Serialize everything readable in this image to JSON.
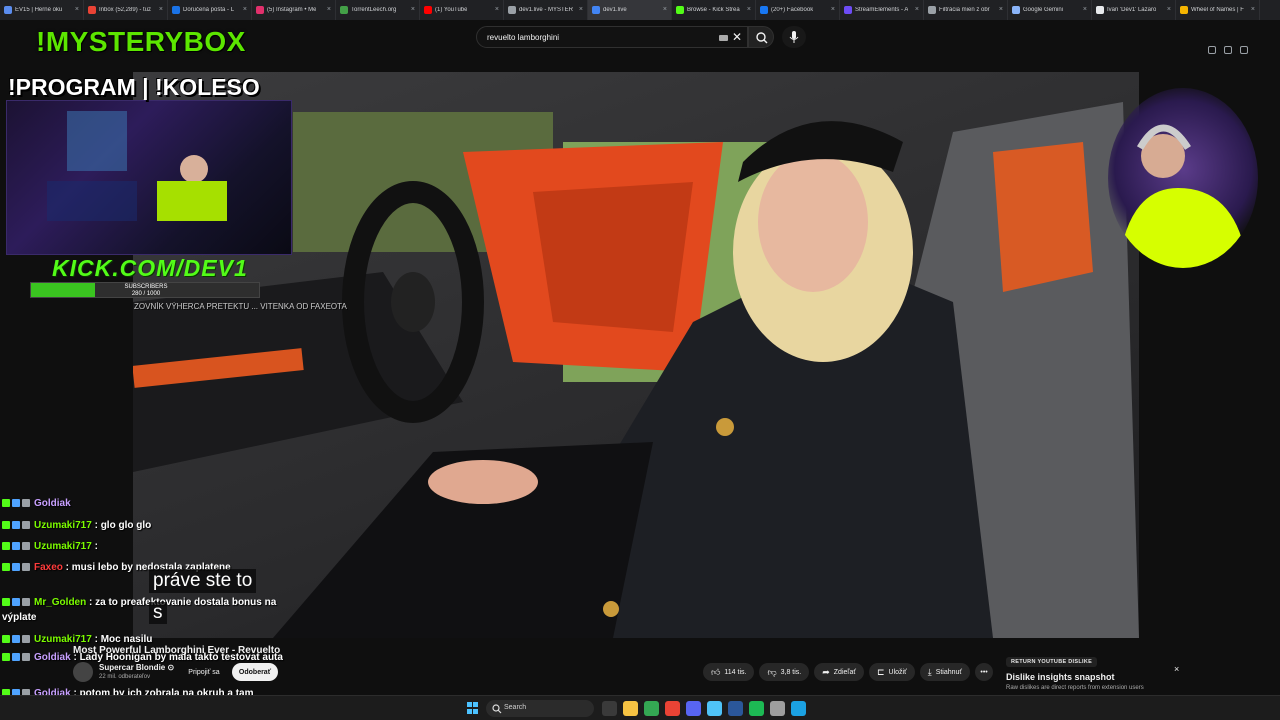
{
  "browser": {
    "tabs": [
      {
        "title": "EV15 | Herné oku",
        "favicon_color": "#5b8def"
      },
      {
        "title": "Inbox (52,289) - tuz",
        "favicon_color": "#ea4335"
      },
      {
        "title": "Doručená pošta - L",
        "favicon_color": "#1a73e8"
      },
      {
        "title": "(5) Instagram • Me",
        "favicon_color": "#e1306c"
      },
      {
        "title": "TorrentLeech.org",
        "favicon_color": "#43a047"
      },
      {
        "title": "(1) YouTube",
        "favicon_color": "#ff0000"
      },
      {
        "title": "dev1.live - MYSTERY",
        "favicon_color": "#9aa0a6"
      },
      {
        "title": "dev1.live",
        "favicon_color": "#4285f4",
        "active": true
      },
      {
        "title": "Browse - Kick Strea",
        "favicon_color": "#53fc18"
      },
      {
        "title": "(20+) Facebook",
        "favicon_color": "#1877f2"
      },
      {
        "title": "StreamElements - A",
        "favicon_color": "#6d4cf5"
      },
      {
        "title": "Filtrácia mien z obr",
        "favicon_color": "#9aa0a6"
      },
      {
        "title": "Google Gemini",
        "favicon_color": "#8ab4f8"
      },
      {
        "title": "Ivan 'Dev1' Lazaro",
        "favicon_color": "#e8eaed"
      },
      {
        "title": "Wheel of Names | F",
        "favicon_color": "#f4b400"
      }
    ]
  },
  "search": {
    "query": "revuelto lamborghini",
    "clear_glyph": "✕",
    "search_icon": "search-icon",
    "mic_icon": "mic-icon"
  },
  "overlay": {
    "mysterybox": "!MYSTERYBOX",
    "program": "!PROGRAM | !KOLESO",
    "kick_logo": "KICK.COM/DEV1",
    "subscribers_label": "SUBSCRIBERS",
    "subscribers_count": "280 / 1000",
    "subscribers_fraction": 0.28,
    "ticker": "ZOVNÍK VÝHERCA PRETEKTU ... VITENKA OD FAXEOTA",
    "accent_green": "#53fc18"
  },
  "chat": [
    {
      "user": "Goldiak",
      "user_color": "#c8a0ff",
      "text": ""
    },
    {
      "user": "Uzumaki717",
      "user_color": "#7cfc00",
      "text": ": glo glo glo"
    },
    {
      "user": "Uzumaki717",
      "user_color": "#7cfc00",
      "text": ":"
    },
    {
      "user": "Faxeo",
      "user_color": "#ff3b3b",
      "text": ": musi lebo by nedostala zaplatene"
    },
    {
      "user": "Mr_Golden",
      "user_color": "#7cfc00",
      "text": ": za to preafektovanie dostala bonus na výplate"
    },
    {
      "user": "Uzumaki717",
      "user_color": "#7cfc00",
      "text": ": Moc nasilu"
    },
    {
      "user": "Goldiak",
      "user_color": "#c8a0ff",
      "text": ": Lady Hoonigan by mala takto testovat auta"
    },
    {
      "user": "Goldiak",
      "user_color": "#c8a0ff",
      "text": ": potom by ich zobrala na okruh a tam driftovala"
    }
  ],
  "captions": {
    "line1": "práve ste to",
    "line2": "s"
  },
  "video": {
    "title": "Most Powerful Lamborghini Ever - Revuelto",
    "channel": "Supercar Blondie ⊙",
    "channel_subs": "22 mil. odberateľov",
    "join_label": "Pripojiť sa",
    "subscribe_label": "Odoberať",
    "likes": "114 tis.",
    "dislikes": "3,8 tis.",
    "share_label": "Zdieľať",
    "save_label": "Uložiť",
    "download_label": "Stiahnuť",
    "more_glyph": "•••"
  },
  "dislike_panel": {
    "badge": "RETURN YOUTUBE DISLIKE",
    "title": "Dislike insights snapshot",
    "description": "Raw dislikes are direct reports from extension users",
    "close_glyph": "×"
  },
  "taskbar": {
    "search_label": "Search",
    "apps": [
      {
        "name": "task-view",
        "color": "#3a3a3a"
      },
      {
        "name": "file-explorer",
        "color": "#f6c343"
      },
      {
        "name": "chrome",
        "color": "#34a853"
      },
      {
        "name": "chrome-alt",
        "color": "#ea4335"
      },
      {
        "name": "discord",
        "color": "#5865f2"
      },
      {
        "name": "notepad",
        "color": "#4fc3f7"
      },
      {
        "name": "word",
        "color": "#2b579a"
      },
      {
        "name": "spotify",
        "color": "#1db954"
      },
      {
        "name": "settings",
        "color": "#9e9e9e"
      },
      {
        "name": "edge",
        "color": "#1ba1e2"
      }
    ]
  }
}
